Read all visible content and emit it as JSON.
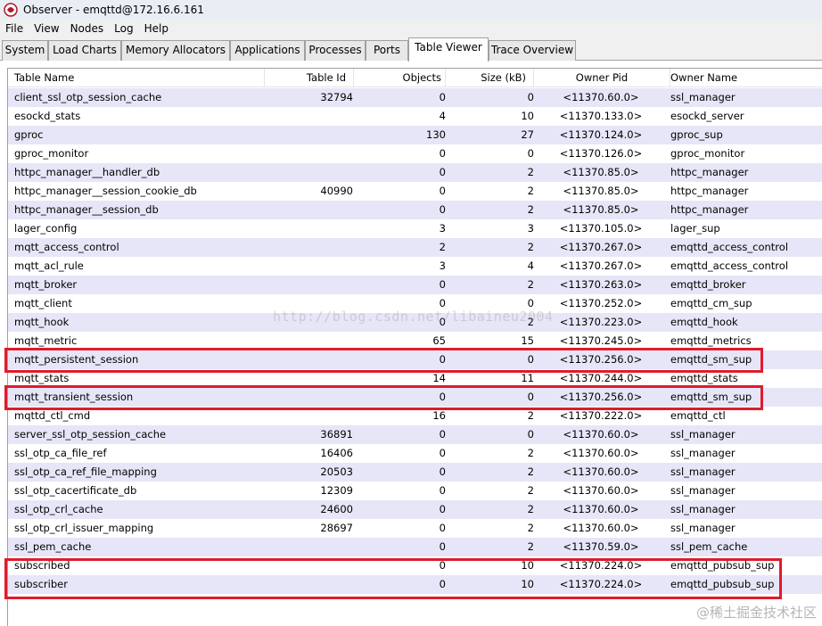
{
  "window": {
    "title": "Observer - emqttd@172.16.6.161"
  },
  "menu": [
    "File",
    "View",
    "Nodes",
    "Log",
    "Help"
  ],
  "tabs": [
    "System",
    "Load Charts",
    "Memory Allocators",
    "Applications",
    "Processes",
    "Ports",
    "Table Viewer",
    "Trace Overview"
  ],
  "active_tab": "Table Viewer",
  "table": {
    "columns": [
      "Table Name",
      "Table Id",
      "Objects",
      "Size (kB)",
      "Owner Pid",
      "Owner Name"
    ],
    "rows": [
      {
        "name": "client_ssl_otp_session_cache",
        "id": "32794",
        "objects": "0",
        "size": "0",
        "pid": "<11370.60.0>",
        "owner": "ssl_manager"
      },
      {
        "name": "esockd_stats",
        "id": "",
        "objects": "4",
        "size": "10",
        "pid": "<11370.133.0>",
        "owner": "esockd_server"
      },
      {
        "name": "gproc",
        "id": "",
        "objects": "130",
        "size": "27",
        "pid": "<11370.124.0>",
        "owner": "gproc_sup"
      },
      {
        "name": "gproc_monitor",
        "id": "",
        "objects": "0",
        "size": "0",
        "pid": "<11370.126.0>",
        "owner": "gproc_monitor"
      },
      {
        "name": "httpc_manager__handler_db",
        "id": "",
        "objects": "0",
        "size": "2",
        "pid": "<11370.85.0>",
        "owner": "httpc_manager"
      },
      {
        "name": "httpc_manager__session_cookie_db",
        "id": "40990",
        "objects": "0",
        "size": "2",
        "pid": "<11370.85.0>",
        "owner": "httpc_manager"
      },
      {
        "name": "httpc_manager__session_db",
        "id": "",
        "objects": "0",
        "size": "2",
        "pid": "<11370.85.0>",
        "owner": "httpc_manager"
      },
      {
        "name": "lager_config",
        "id": "",
        "objects": "3",
        "size": "3",
        "pid": "<11370.105.0>",
        "owner": "lager_sup"
      },
      {
        "name": "mqtt_access_control",
        "id": "",
        "objects": "2",
        "size": "2",
        "pid": "<11370.267.0>",
        "owner": "emqttd_access_control"
      },
      {
        "name": "mqtt_acl_rule",
        "id": "",
        "objects": "3",
        "size": "4",
        "pid": "<11370.267.0>",
        "owner": "emqttd_access_control"
      },
      {
        "name": "mqtt_broker",
        "id": "",
        "objects": "0",
        "size": "2",
        "pid": "<11370.263.0>",
        "owner": "emqttd_broker"
      },
      {
        "name": "mqtt_client",
        "id": "",
        "objects": "0",
        "size": "0",
        "pid": "<11370.252.0>",
        "owner": "emqttd_cm_sup"
      },
      {
        "name": "mqtt_hook",
        "id": "",
        "objects": "0",
        "size": "2",
        "pid": "<11370.223.0>",
        "owner": "emqttd_hook"
      },
      {
        "name": "mqtt_metric",
        "id": "",
        "objects": "65",
        "size": "15",
        "pid": "<11370.245.0>",
        "owner": "emqttd_metrics"
      },
      {
        "name": "mqtt_persistent_session",
        "id": "",
        "objects": "0",
        "size": "0",
        "pid": "<11370.256.0>",
        "owner": "emqttd_sm_sup"
      },
      {
        "name": "mqtt_stats",
        "id": "",
        "objects": "14",
        "size": "11",
        "pid": "<11370.244.0>",
        "owner": "emqttd_stats"
      },
      {
        "name": "mqtt_transient_session",
        "id": "",
        "objects": "0",
        "size": "0",
        "pid": "<11370.256.0>",
        "owner": "emqttd_sm_sup"
      },
      {
        "name": "mqttd_ctl_cmd",
        "id": "",
        "objects": "16",
        "size": "2",
        "pid": "<11370.222.0>",
        "owner": "emqttd_ctl"
      },
      {
        "name": "server_ssl_otp_session_cache",
        "id": "36891",
        "objects": "0",
        "size": "0",
        "pid": "<11370.60.0>",
        "owner": "ssl_manager"
      },
      {
        "name": "ssl_otp_ca_file_ref",
        "id": "16406",
        "objects": "0",
        "size": "2",
        "pid": "<11370.60.0>",
        "owner": "ssl_manager"
      },
      {
        "name": "ssl_otp_ca_ref_file_mapping",
        "id": "20503",
        "objects": "0",
        "size": "2",
        "pid": "<11370.60.0>",
        "owner": "ssl_manager"
      },
      {
        "name": "ssl_otp_cacertificate_db",
        "id": "12309",
        "objects": "0",
        "size": "2",
        "pid": "<11370.60.0>",
        "owner": "ssl_manager"
      },
      {
        "name": "ssl_otp_crl_cache",
        "id": "24600",
        "objects": "0",
        "size": "2",
        "pid": "<11370.60.0>",
        "owner": "ssl_manager"
      },
      {
        "name": "ssl_otp_crl_issuer_mapping",
        "id": "28697",
        "objects": "0",
        "size": "2",
        "pid": "<11370.60.0>",
        "owner": "ssl_manager"
      },
      {
        "name": "ssl_pem_cache",
        "id": "",
        "objects": "0",
        "size": "2",
        "pid": "<11370.59.0>",
        "owner": "ssl_pem_cache"
      },
      {
        "name": "subscribed",
        "id": "",
        "objects": "0",
        "size": "10",
        "pid": "<11370.224.0>",
        "owner": "emqttd_pubsub_sup"
      },
      {
        "name": "subscriber",
        "id": "",
        "objects": "0",
        "size": "10",
        "pid": "<11370.224.0>",
        "owner": "emqttd_pubsub_sup"
      }
    ]
  },
  "watermarks": {
    "url": "http://blog.csdn.net/libaineu2004",
    "brand": "@稀土掘金技术社区"
  },
  "colors": {
    "row_alt": "#e6e6f8",
    "highlight": "#e01b2a"
  }
}
